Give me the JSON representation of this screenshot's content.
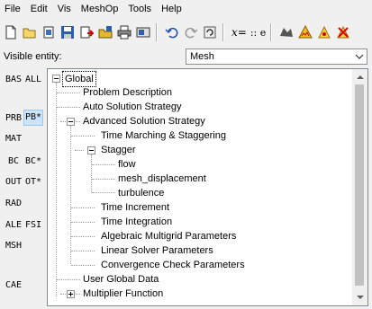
{
  "menu": [
    "File",
    "Edit",
    "Vis",
    "MeshOp",
    "Tools",
    "Help"
  ],
  "toolbar": {
    "xeq_text": "x=",
    "dots_text": ":: e"
  },
  "visible_entity": {
    "label": "Visible entity:",
    "value": "Mesh"
  },
  "side_buttons": {
    "bas": "BAS",
    "all": "ALL",
    "prb": "PRB",
    "pb_star": "PB*",
    "mat": "MAT",
    "bc": "BC",
    "bc_star": "BC*",
    "out": "OUT",
    "ot_star": "OT*",
    "rad": "RAD",
    "ale": "ALE",
    "fsi": "FSI",
    "msh": "MSH",
    "cae": "CAE"
  },
  "tree": {
    "root": "Global",
    "problem_description": "Problem Description",
    "auto_solution_strategy": "Auto Solution Strategy",
    "advanced_solution_strategy": "Advanced Solution Strategy",
    "time_marching": "Time Marching & Staggering",
    "stagger": "Stagger",
    "flow": "flow",
    "mesh_displacement": "mesh_displacement",
    "turbulence": "turbulence",
    "time_increment": "Time Increment",
    "time_integration": "Time Integration",
    "algebraic_multigrid": "Algebraic Multigrid Parameters",
    "linear_solver": "Linear Solver Parameters",
    "convergence_check": "Convergence Check Parameters",
    "user_global_data": "User Global Data",
    "multiplier_function": "Multiplier Function"
  }
}
